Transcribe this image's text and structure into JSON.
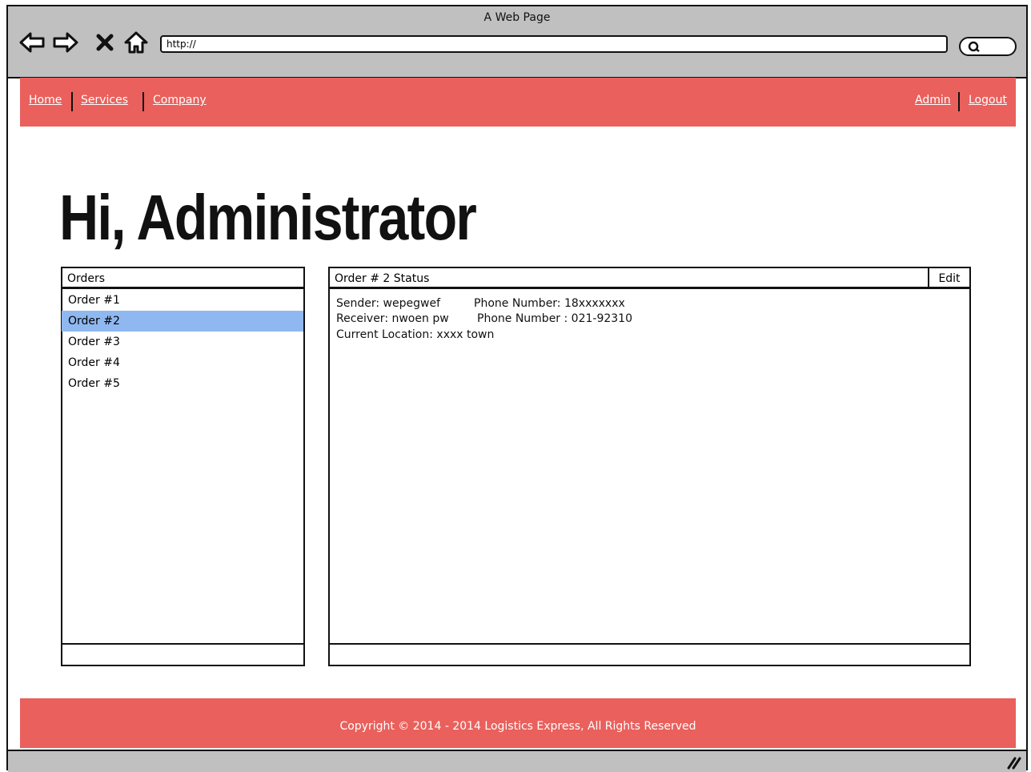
{
  "window": {
    "title": "A Web Page"
  },
  "browser": {
    "url": "http://",
    "icons": [
      "back-icon",
      "forward-icon",
      "close-icon",
      "home-icon",
      "search-icon"
    ]
  },
  "nav": {
    "left": [
      "Home",
      "Services",
      "Company"
    ],
    "right": [
      "Admin",
      "Logout"
    ]
  },
  "heading": "Hi, Administrator",
  "orders": {
    "title": "Orders",
    "items": [
      "Order #1",
      "Order #2",
      "Order #3",
      "Order #4",
      "Order #5"
    ],
    "selected": "Order #2"
  },
  "status": {
    "title": "Order # 2 Status",
    "edit_label": "Edit",
    "sender": "Sender: wepegwef",
    "sender_phone": "Phone Number:  18xxxxxxx",
    "receiver": "Receiver: nwoen pw",
    "receiver_phone": "Phone Number : 021-92310",
    "location": "Current Location:  xxxx town"
  },
  "footer": "Copyright © 2014 - 2014 Logistics Express, All Rights Reserved",
  "colors": {
    "accent": "#e9605c",
    "chrome": "#c0c0c0",
    "selection": "#90b8f0"
  }
}
